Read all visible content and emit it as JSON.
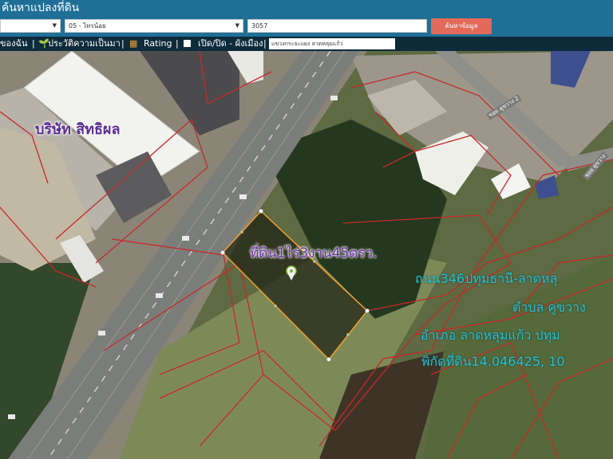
{
  "header": {
    "title": "ค้นหาแปลงที่ดิน",
    "province_select": "",
    "district_select": "05 - ไทรน้อย",
    "parcel_number": "3057",
    "search_button": "ค้นหาข้อมูล"
  },
  "toolbar": {
    "item1": "ของฉัน",
    "item2": "ประวัติความเป็นมา",
    "item3": "Rating",
    "item4": "เปิด/ปิด - ผังเมือง",
    "search_value": "แขวงกระจะแยง ลาดหลุมแก้ว"
  },
  "map": {
    "company_label": "บริษัท สิทธิผล",
    "plot_label": "ที่ดิน1ไร่3งาน45ตรว.",
    "address_line1": "ถนน346ปทุมธานี-ลาดหลุ",
    "address_line2": "ตำบล คูขวาง",
    "address_line3": "อำเภอ ลาดหลุมแก้ว ปทุม",
    "address_line4": "พิกัดที่ดิน14.046425, 10",
    "road_label_1": "ซอย คูขวาง 2",
    "road_label_2": "ซอย คูขวาง"
  },
  "colors": {
    "header_bg": "#1f6f97",
    "toolbar_bg": "#0d2b3b",
    "button_bg": "#e26a5a",
    "parcel_lines": "#c62a2a",
    "selected_parcel": "#f0a030"
  }
}
